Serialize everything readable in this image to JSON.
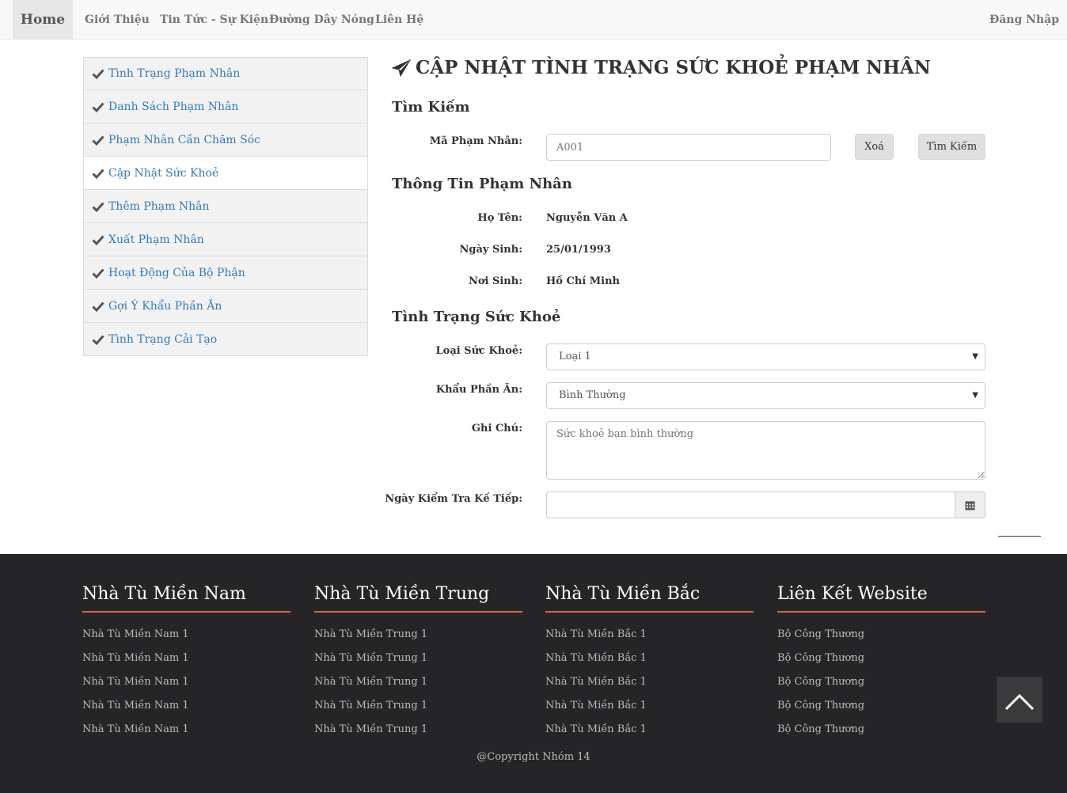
{
  "nav": {
    "home": "Home",
    "items": [
      "Giới Thiệu",
      "Tin Tức - Sự Kiện",
      "Đường Dây Nóng",
      "Liên Hệ"
    ],
    "login": "Đăng Nhập"
  },
  "sidebar": {
    "items": [
      "Tình Trạng Phạm Nhân",
      "Danh Sách Phạm Nhân",
      "Phạm Nhân Cần Chăm Sóc",
      "Cập Nhật Sức Khoẻ",
      "Thêm Phạm Nhân",
      "Xuất Phạm Nhân",
      "Hoạt Động Của Bộ Phận",
      "Gợi Ý Khẩu Phần Ăn",
      "Tình Trạng Cải Tạo"
    ],
    "active_index": 3
  },
  "page": {
    "title": "CẬP NHẬT TÌNH TRẠNG SỨC KHOẺ PHẠM NHÂN",
    "search_heading": "Tìm Kiếm",
    "ma_label": "Mã Phạm Nhân:",
    "ma_placeholder": "A001",
    "clear_button": "Xoá",
    "search_button": "Tìm Kiếm",
    "info_heading": "Thông Tin Phạm Nhân",
    "name_label": "Họ Tên:",
    "name_value": "Nguyễn Văn A",
    "dob_label": "Ngày Sinh:",
    "dob_value": "25/01/1993",
    "pob_label": "Nơi Sinh:",
    "pob_value": "Hồ Chí Minh",
    "health_heading": "Tình Trạng Sức Khoẻ",
    "health_type_label": "Loại Sức Khoẻ:",
    "health_type_value": "Loại 1",
    "ration_label": "Khẩu Phần Ăn:",
    "ration_value": "Bình Thường",
    "note_label": "Ghi Chú:",
    "note_placeholder": "Sức khoẻ bạn bình thường",
    "next_check_label": "Ngày Kiểm Tra Kế Tiếp:"
  },
  "footer": {
    "columns": [
      {
        "title": "Nhà Tù Miền Nam",
        "links": [
          "Nhà Tù Miền Nam 1",
          "Nhà Tù Miền Nam 1",
          "Nhà Tù Miền Nam 1",
          "Nhà Tù Miền Nam 1",
          "Nhà Tù Miền Nam 1"
        ]
      },
      {
        "title": "Nhà Tù Miền Trung",
        "links": [
          "Nhà Tù Miền Trung 1",
          "Nhà Tù Miền Trung 1",
          "Nhà Tù Miền Trung 1",
          "Nhà Tù Miền Trung 1",
          "Nhà Tù Miền Trung 1"
        ]
      },
      {
        "title": "Nhà Tù Miền Bắc",
        "links": [
          "Nhà Tù Miền Bắc 1",
          "Nhà Tù Miền Bắc 1",
          "Nhà Tù Miền Bắc 1",
          "Nhà Tù Miền Bắc 1",
          "Nhà Tù Miền Bắc 1"
        ]
      },
      {
        "title": "Liên Kết Website",
        "links": [
          "Bộ Công Thương",
          "Bộ Công Thương",
          "Bộ Công Thương",
          "Bộ Công Thương",
          "Bộ Công Thương"
        ]
      }
    ],
    "copyright": "@Copyright Nhóm 14"
  },
  "colors": {
    "accent_line": "#e1604a",
    "footer_bg": "#252528",
    "link": "#337ab7"
  },
  "icons": {
    "sidebar": "check-icon",
    "title": "paper-plane-icon",
    "calendar": "calendar-icon",
    "to_top": "chevron-up-icon"
  }
}
